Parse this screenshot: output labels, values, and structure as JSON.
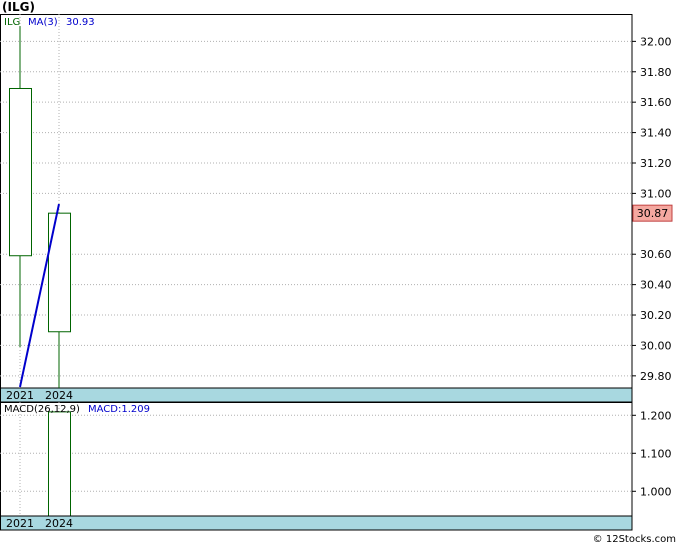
{
  "title": "(ILG)",
  "footer": "© 12Stocks.com",
  "colors": {
    "candle": "#006400",
    "ma_line": "#0000cc",
    "grid": "#b0b0b0",
    "date_band": "#a8d8e0",
    "price_badge_bg": "#f4a8a0"
  },
  "chart_data": [
    {
      "type": "candlestick",
      "legend": {
        "symbol": "ILG",
        "ma_label": "MA(3)",
        "ma_value": "30.93"
      },
      "x_labels": [
        "2021",
        "2024"
      ],
      "candles": [
        {
          "x": "2021",
          "open": 30.59,
          "close": 31.69,
          "high": 32.1,
          "low": 29.99
        },
        {
          "x": "2024",
          "open": 30.09,
          "close": 30.87,
          "high": 30.87,
          "low": 29.72
        }
      ],
      "ma_series": [
        {
          "x": "2021",
          "value": 29.72
        },
        {
          "x": "2024",
          "value": 30.93
        }
      ],
      "y_ticks": [
        "32.00",
        "31.80",
        "31.60",
        "31.40",
        "31.20",
        "31.00",
        "30.60",
        "30.40",
        "30.20",
        "30.00",
        "29.80"
      ],
      "ylim": [
        29.72,
        32.18
      ],
      "last_price": "30.87",
      "grid": true
    },
    {
      "type": "bar",
      "legend": {
        "label": "MACD(26,12,9)",
        "value_label": "MACD:1.209"
      },
      "x_labels": [
        "2021",
        "2024"
      ],
      "bars": [
        {
          "x": "2024",
          "value": 1.209
        }
      ],
      "y_ticks": [
        "1.200",
        "1.100",
        "1.000"
      ],
      "ylim": [
        0.935,
        1.235
      ],
      "grid": true
    }
  ]
}
